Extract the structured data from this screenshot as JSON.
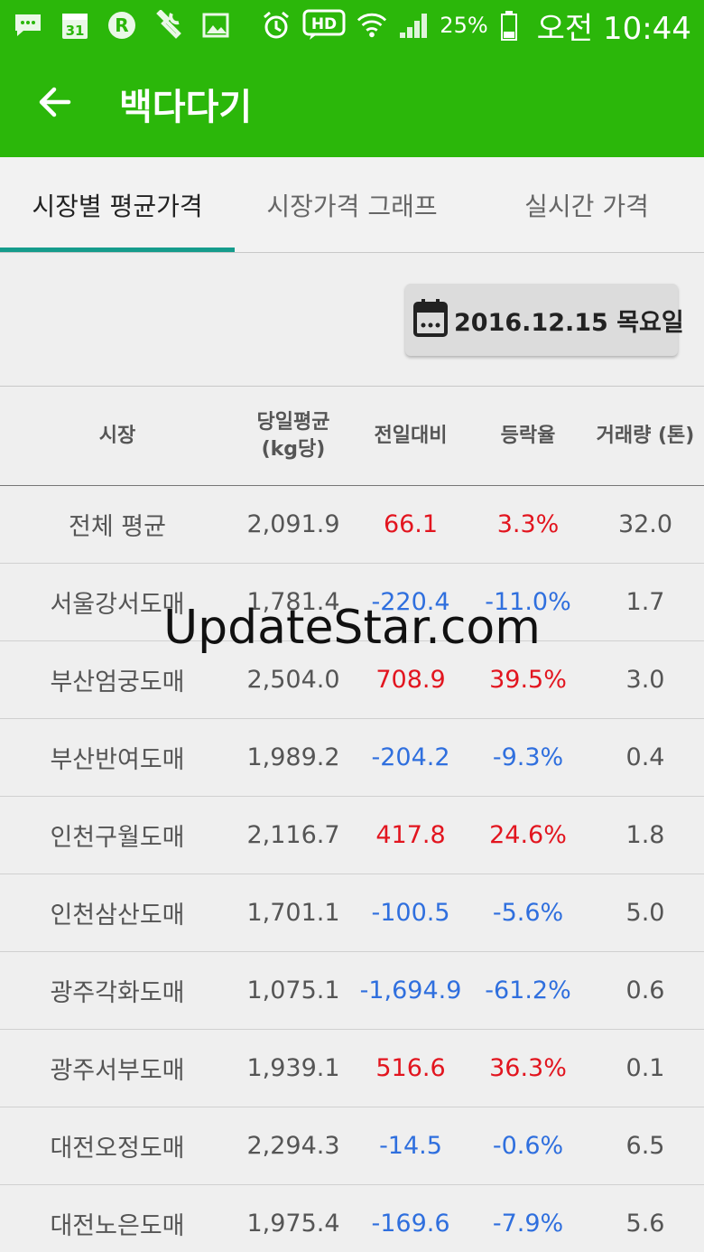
{
  "status_bar": {
    "battery_percent": "25%",
    "clock": "오전 10:44",
    "calendar_day": "31",
    "hd_label": "HD",
    "r_label": "R",
    "icons": [
      "message-icon",
      "calendar-icon",
      "r-app-icon",
      "wrench-icon",
      "image-icon",
      "alarm-icon",
      "hd-voice-icon",
      "wifi-icon",
      "signal-icon",
      "battery-icon"
    ]
  },
  "app_bar": {
    "title": "백다다기",
    "back_icon": "arrow-left-icon"
  },
  "tabs": [
    {
      "label": "시장별 평균가격",
      "active": true
    },
    {
      "label": "시장가격 그래프",
      "active": false
    },
    {
      "label": "실시간 가격",
      "active": false
    }
  ],
  "date_button": {
    "label": "2016.12.15 목요일",
    "icon": "calendar-icon"
  },
  "table": {
    "headers": [
      "시장",
      "당일평균\n(kg당)",
      "전일대비",
      "등락율",
      "거래량 (톤)"
    ],
    "rows": [
      {
        "market": "전체 평균",
        "avg": "2,091.9",
        "diff": "66.1",
        "rate": "3.3%",
        "volume": "32.0",
        "trend": "up"
      },
      {
        "market": "서울강서도매",
        "avg": "1,781.4",
        "diff": "-220.4",
        "rate": "-11.0%",
        "volume": "1.7",
        "trend": "down"
      },
      {
        "market": "부산엄궁도매",
        "avg": "2,504.0",
        "diff": "708.9",
        "rate": "39.5%",
        "volume": "3.0",
        "trend": "up"
      },
      {
        "market": "부산반여도매",
        "avg": "1,989.2",
        "diff": "-204.2",
        "rate": "-9.3%",
        "volume": "0.4",
        "trend": "down"
      },
      {
        "market": "인천구월도매",
        "avg": "2,116.7",
        "diff": "417.8",
        "rate": "24.6%",
        "volume": "1.8",
        "trend": "up"
      },
      {
        "market": "인천삼산도매",
        "avg": "1,701.1",
        "diff": "-100.5",
        "rate": "-5.6%",
        "volume": "5.0",
        "trend": "down"
      },
      {
        "market": "광주각화도매",
        "avg": "1,075.1",
        "diff": "-1,694.9",
        "rate": "-61.2%",
        "volume": "0.6",
        "trend": "down"
      },
      {
        "market": "광주서부도매",
        "avg": "1,939.1",
        "diff": "516.6",
        "rate": "36.3%",
        "volume": "0.1",
        "trend": "up"
      },
      {
        "market": "대전오정도매",
        "avg": "2,294.3",
        "diff": "-14.5",
        "rate": "-0.6%",
        "volume": "6.5",
        "trend": "down"
      },
      {
        "market": "대전노은도매",
        "avg": "1,975.4",
        "diff": "-169.6",
        "rate": "-7.9%",
        "volume": "5.6",
        "trend": "down"
      }
    ]
  },
  "watermark": "UpdateStar.com",
  "colors": {
    "app_bar": "#2bb70a",
    "tab_indicator": "#159c8c",
    "up": "#e2151f",
    "down": "#2f6fde"
  }
}
